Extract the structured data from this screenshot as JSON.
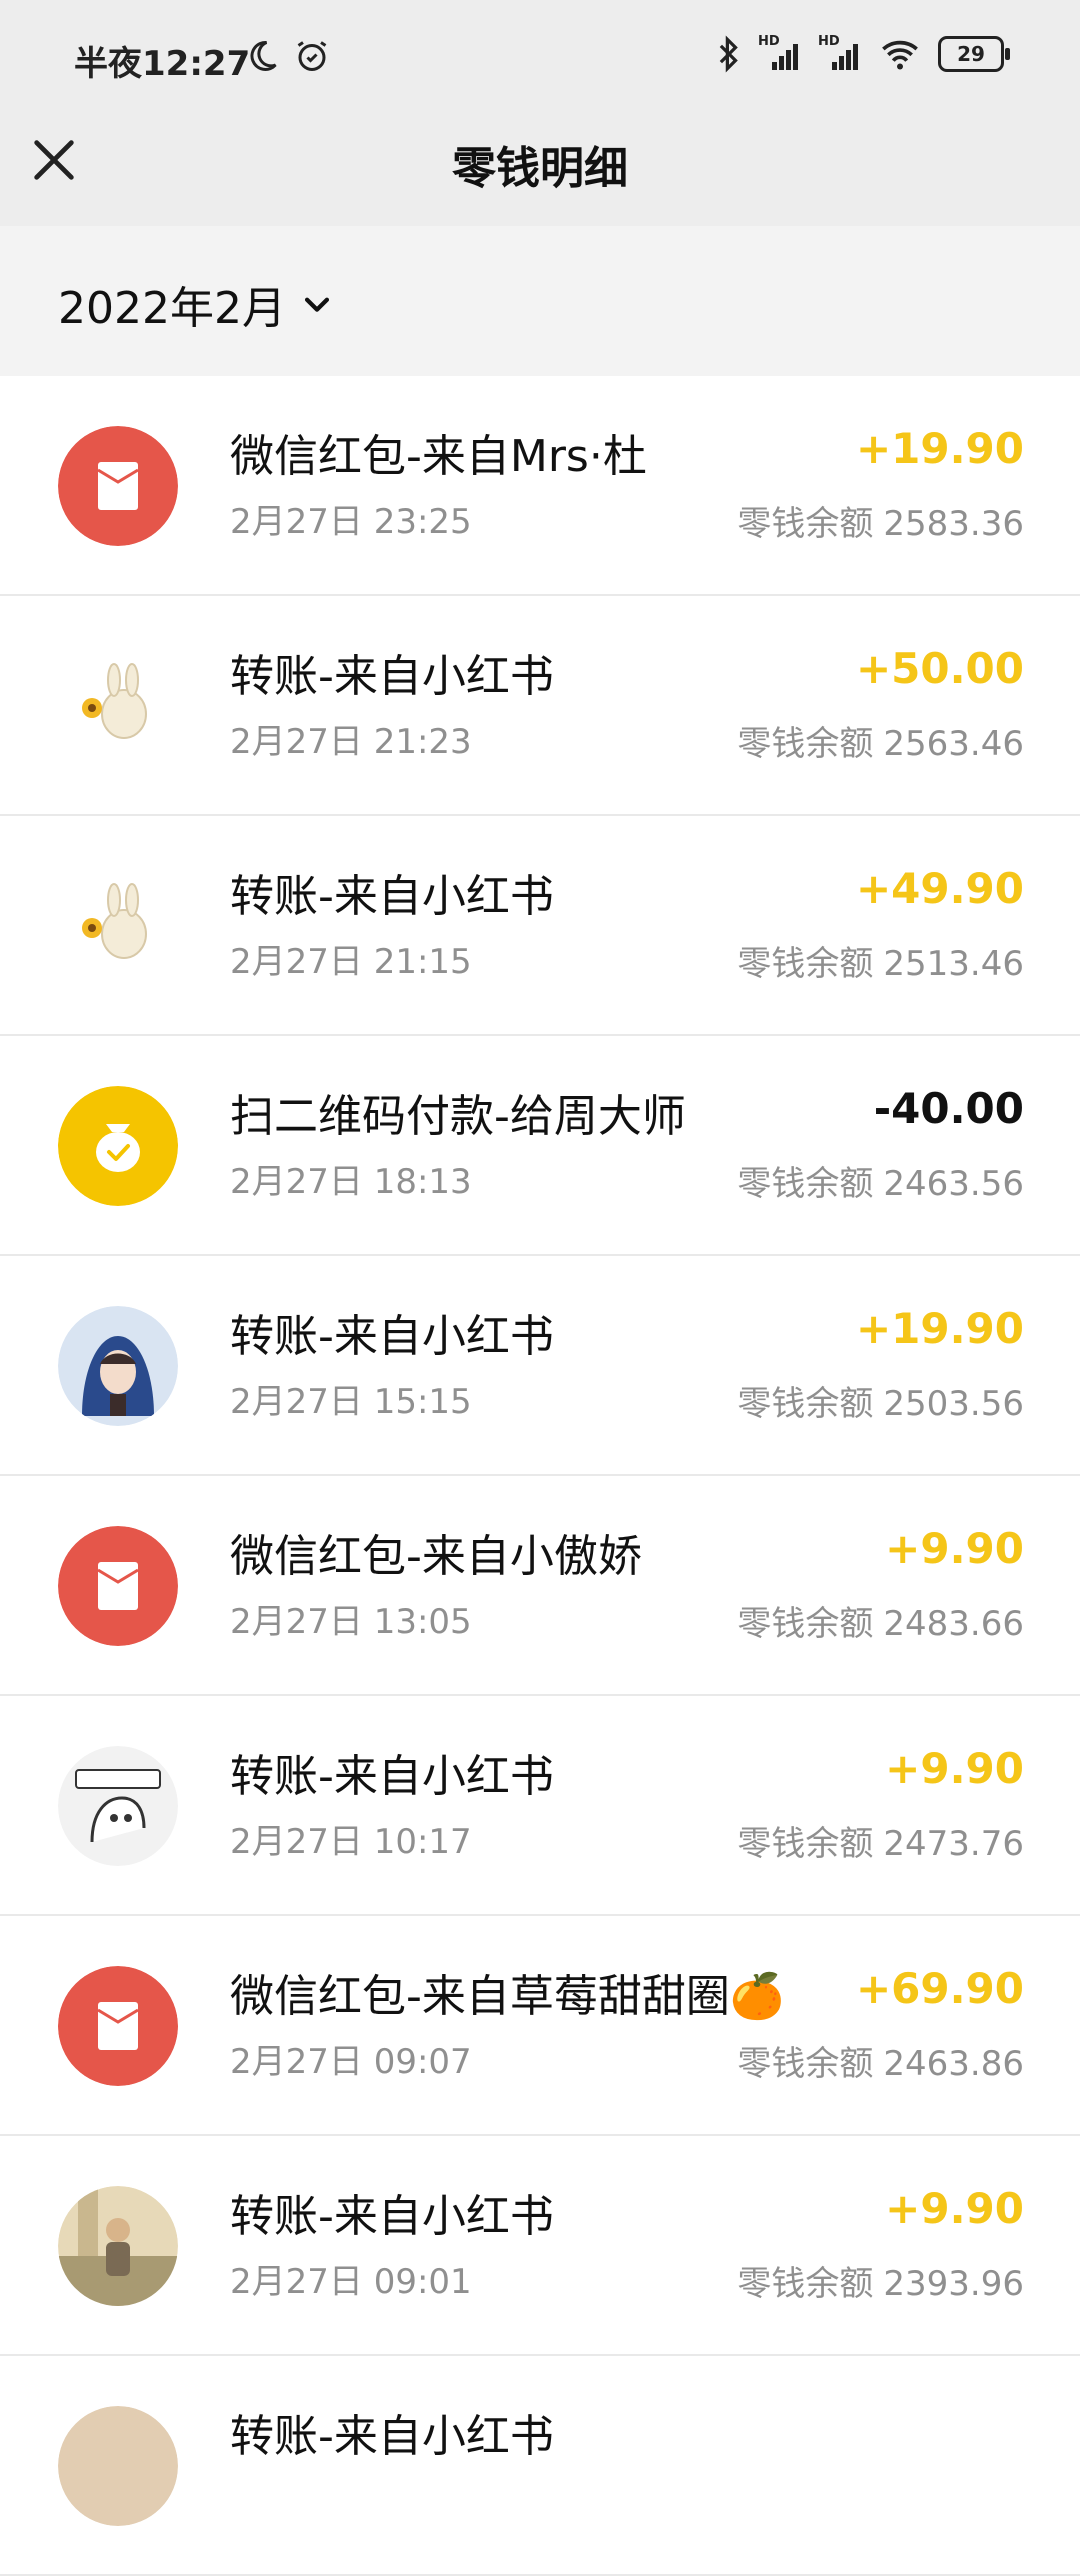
{
  "status_bar": {
    "time": "半夜12:27",
    "hd1": "HD",
    "hd2": "HD",
    "battery": "29"
  },
  "header": {
    "title": "零钱明细"
  },
  "month_filter": {
    "label": "2022年2月"
  },
  "colors": {
    "income": "#f5c518",
    "expense": "#111111",
    "red_packet": "#e5564a",
    "qr_pay": "#f5c400"
  },
  "transactions": [
    {
      "title": "微信红包-来自Mrs·杜",
      "time": "2月27日 23:25",
      "amount": "+19.90",
      "balance_label": "零钱余额",
      "balance": "2583.36",
      "icon": "red-packet-icon"
    },
    {
      "title": "转账-来自小红书",
      "time": "2月27日 21:23",
      "amount": "+50.00",
      "balance_label": "零钱余额",
      "balance": "2563.46",
      "icon": "bunny-avatar"
    },
    {
      "title": "转账-来自小红书",
      "time": "2月27日 21:15",
      "amount": "+49.90",
      "balance_label": "零钱余额",
      "balance": "2513.46",
      "icon": "bunny-avatar"
    },
    {
      "title": "扫二维码付款-给周大师",
      "time": "2月27日 18:13",
      "amount": "-40.00",
      "balance_label": "零钱余额",
      "balance": "2463.56",
      "icon": "money-bag-icon"
    },
    {
      "title": "转账-来自小红书",
      "time": "2月27日 15:15",
      "amount": "+19.90",
      "balance_label": "零钱余额",
      "balance": "2503.56",
      "icon": "hooded-avatar"
    },
    {
      "title": "微信红包-来自小傲娇",
      "time": "2月27日 13:05",
      "amount": "+9.90",
      "balance_label": "零钱余额",
      "balance": "2483.66",
      "icon": "red-packet-icon"
    },
    {
      "title": "转账-来自小红书",
      "time": "2月27日 10:17",
      "amount": "+9.90",
      "balance_label": "零钱余额",
      "balance": "2473.76",
      "icon": "cartoon-avatar"
    },
    {
      "title": "微信红包-来自草莓甜甜圈🍊",
      "time": "2月27日 09:07",
      "amount": "+69.90",
      "balance_label": "零钱余额",
      "balance": "2463.86",
      "icon": "red-packet-icon"
    },
    {
      "title": "转账-来自小红书",
      "time": "2月27日 09:01",
      "amount": "+9.90",
      "balance_label": "零钱余额",
      "balance": "2393.96",
      "icon": "photo-avatar"
    },
    {
      "title": "转账-来自小红书",
      "time": "",
      "amount": "",
      "balance_label": "",
      "balance": "",
      "icon": "photo-avatar"
    }
  ]
}
